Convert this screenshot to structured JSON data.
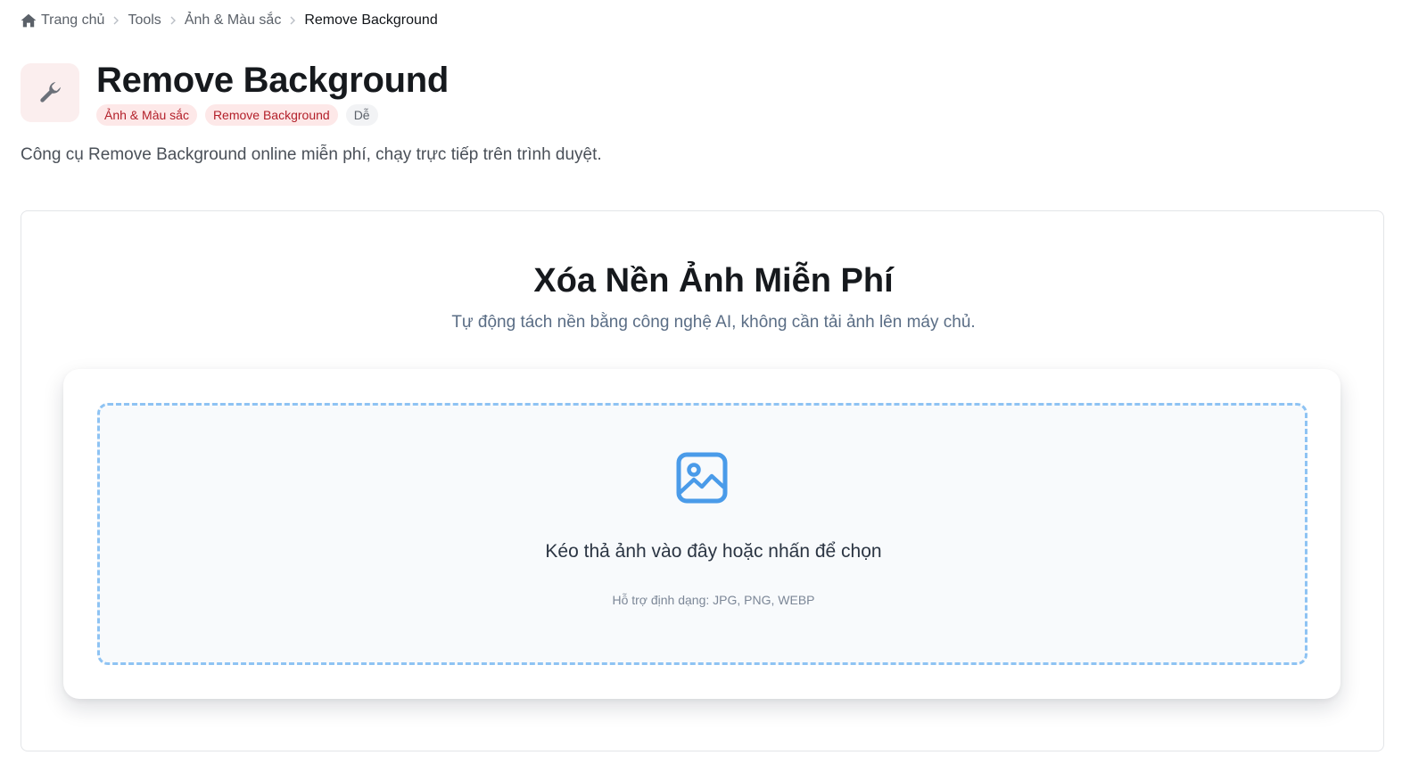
{
  "breadcrumb": {
    "home": "Trang chủ",
    "tools": "Tools",
    "category": "Ảnh & Màu sắc",
    "current": "Remove Background"
  },
  "header": {
    "title": "Remove Background",
    "tool_icon": "wrench-icon",
    "tags": [
      {
        "label": "Ảnh & Màu sắc",
        "color": "#b3202a"
      },
      {
        "label": "Remove Background",
        "color": "#b3202a"
      },
      {
        "label": "Dễ",
        "color": "#5b6169"
      }
    ],
    "description": "Công cụ Remove Background online miễn phí, chạy trực tiếp trên trình duyệt."
  },
  "tool": {
    "title": "Xóa Nền Ảnh Miễn Phí",
    "subtitle": "Tự động tách nền bằng công nghệ AI, không cần tải ảnh lên máy chủ.",
    "dropzone": {
      "icon": "image-icon",
      "prompt": "Kéo thả ảnh vào đây hoặc nhấn để chọn",
      "formats": "Hỗ trợ định dạng: JPG, PNG, WEBP"
    }
  },
  "colors": {
    "accent_blue": "#4a9be9",
    "tag_red": "#b3202a",
    "tag_red_bg": "#fde8e8",
    "dropzone_border": "#8ec3f3"
  }
}
